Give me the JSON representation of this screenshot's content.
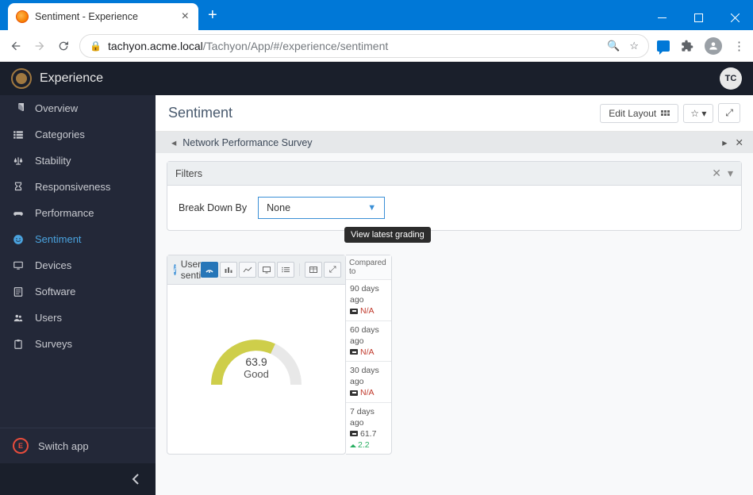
{
  "browser": {
    "tab_title": "Sentiment - Experience",
    "url_host": "tachyon.acme.local",
    "url_path": "/Tachyon/App/#/experience/sentiment"
  },
  "app": {
    "name": "Experience",
    "user_initials": "TC"
  },
  "sidebar": {
    "items": [
      {
        "label": "Overview",
        "icon": "◔"
      },
      {
        "label": "Categories",
        "icon": "⊞"
      },
      {
        "label": "Stability",
        "icon": "⚖"
      },
      {
        "label": "Responsiveness",
        "icon": "⧗"
      },
      {
        "label": "Performance",
        "icon": "🎮"
      },
      {
        "label": "Sentiment",
        "icon": "☺"
      },
      {
        "label": "Devices",
        "icon": "🖵"
      },
      {
        "label": "Software",
        "icon": "≣"
      },
      {
        "label": "Users",
        "icon": "👥"
      },
      {
        "label": "Surveys",
        "icon": "📋"
      }
    ],
    "switch_label": "Switch app"
  },
  "page": {
    "title": "Sentiment",
    "edit_layout": "Edit Layout"
  },
  "survey_bar": {
    "title": "Network Performance Survey"
  },
  "filters": {
    "title": "Filters",
    "breakdown_label": "Break Down By",
    "breakdown_value": "None"
  },
  "tooltip": {
    "text": "View latest grading"
  },
  "widget": {
    "title": "User senti",
    "gauge_value": "63.9",
    "gauge_label": "Good",
    "chart_data": {
      "type": "gauge",
      "value": 63.9,
      "min": 0,
      "max": 100,
      "label": "Good",
      "color": "#cece4a"
    },
    "compare_header": "Compared to",
    "comparisons": [
      {
        "title": "90 days ago",
        "value": "N/A"
      },
      {
        "title": "60 days ago",
        "value": "N/A"
      },
      {
        "title": "30 days ago",
        "value": "N/A"
      },
      {
        "title": "7 days ago",
        "value": "61.7",
        "delta": "2.2"
      }
    ]
  }
}
